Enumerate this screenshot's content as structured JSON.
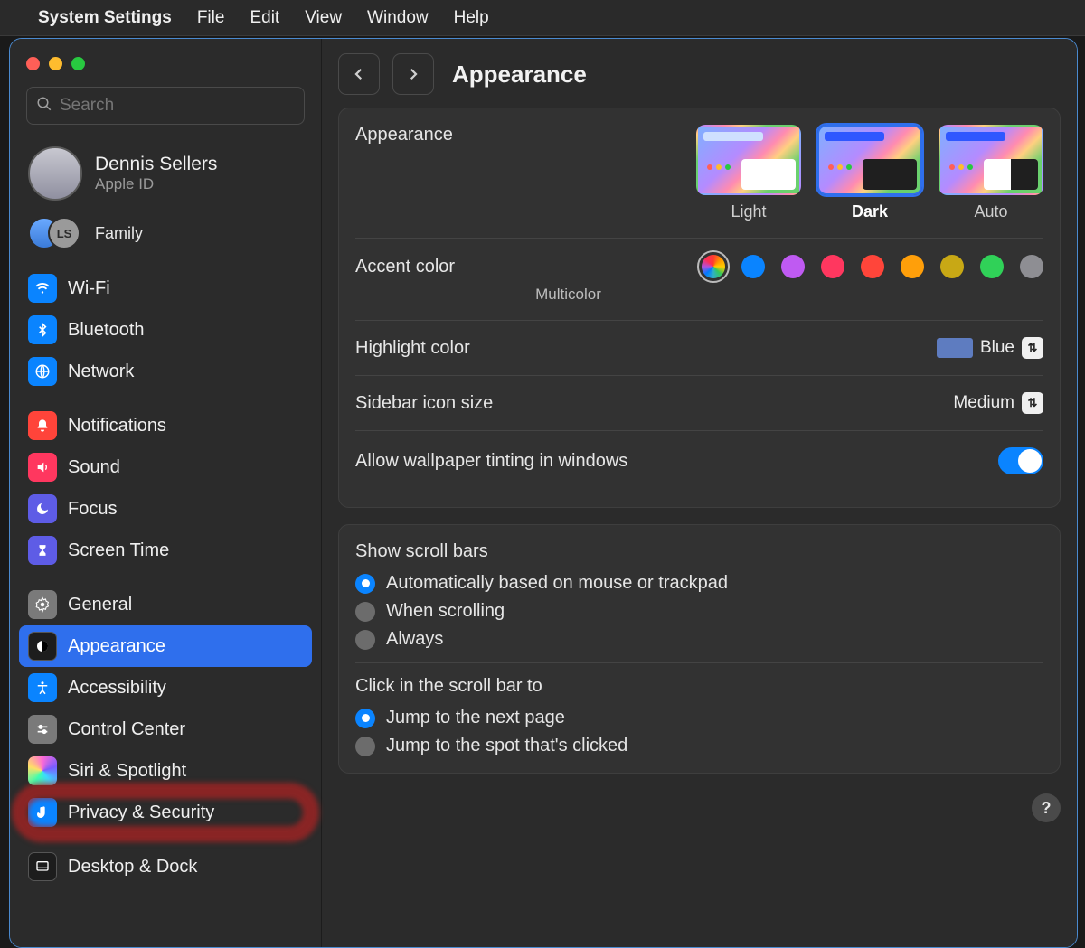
{
  "menubar": {
    "app": "System Settings",
    "items": [
      "File",
      "Edit",
      "View",
      "Window",
      "Help"
    ]
  },
  "search": {
    "placeholder": "Search"
  },
  "account": {
    "name": "Dennis Sellers",
    "subtitle": "Apple ID"
  },
  "family": {
    "label": "Family",
    "badge": "LS"
  },
  "sidebar": {
    "group1": [
      {
        "label": "Wi-Fi"
      },
      {
        "label": "Bluetooth"
      },
      {
        "label": "Network"
      }
    ],
    "group2": [
      {
        "label": "Notifications"
      },
      {
        "label": "Sound"
      },
      {
        "label": "Focus"
      },
      {
        "label": "Screen Time"
      }
    ],
    "group3": [
      {
        "label": "General"
      },
      {
        "label": "Appearance"
      },
      {
        "label": "Accessibility"
      },
      {
        "label": "Control Center"
      },
      {
        "label": "Siri & Spotlight"
      },
      {
        "label": "Privacy & Security"
      }
    ],
    "group4": [
      {
        "label": "Desktop & Dock"
      }
    ]
  },
  "page": {
    "title": "Appearance",
    "appearance_label": "Appearance",
    "appearance_options": {
      "light": "Light",
      "dark": "Dark",
      "auto": "Auto",
      "selected": "dark"
    },
    "accent": {
      "label": "Accent color",
      "selected_name": "Multicolor"
    },
    "highlight": {
      "label": "Highlight color",
      "value": "Blue"
    },
    "sidebar_icon": {
      "label": "Sidebar icon size",
      "value": "Medium"
    },
    "tinting": {
      "label": "Allow wallpaper tinting in windows",
      "on": true
    },
    "scrollbars": {
      "title": "Show scroll bars",
      "options": [
        "Automatically based on mouse or trackpad",
        "When scrolling",
        "Always"
      ],
      "selected": 0
    },
    "click_scroll": {
      "title": "Click in the scroll bar to",
      "options": [
        "Jump to the next page",
        "Jump to the spot that's clicked"
      ],
      "selected": 0
    }
  }
}
